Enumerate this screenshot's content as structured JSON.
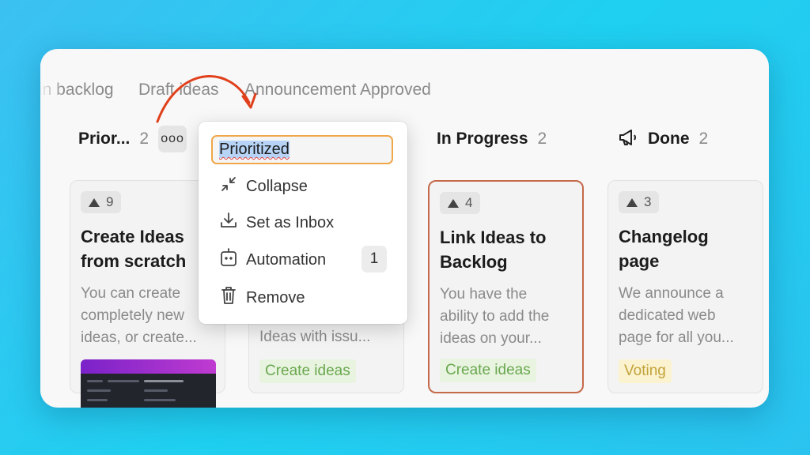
{
  "tabs": [
    "in backlog",
    "Draft ideas",
    "Announcement Approved"
  ],
  "columns": [
    {
      "title": "Prior...",
      "count": "2",
      "more": "ooo"
    },
    {
      "title": "In Progress",
      "count": "2"
    },
    {
      "title": "Done",
      "count": "2",
      "icon": "megaphone-icon"
    }
  ],
  "cards": [
    {
      "votes": "9",
      "title_1": "Create Ideas",
      "title_2": "from scratch",
      "desc_1": "You can create",
      "desc_2": "completely new",
      "desc_3": "ideas, or create..."
    },
    {
      "desc_3": "Ideas with issu...",
      "tag": "Create ideas"
    },
    {
      "votes": "4",
      "title_1": "Link Ideas to",
      "title_2": "Backlog",
      "desc_1": "You have the",
      "desc_2": "ability to add the",
      "desc_3": "ideas on your...",
      "tag": "Create ideas"
    },
    {
      "votes": "3",
      "title_1": "Changelog",
      "title_2": "page",
      "desc_1": "We announce a",
      "desc_2": "dedicated web",
      "desc_3": "page for all you...",
      "tag": "Voting"
    }
  ],
  "menu": {
    "rename_value": "Prioritized",
    "items": [
      "Collapse",
      "Set as Inbox",
      "Automation",
      "Remove"
    ],
    "automation_count": "1"
  },
  "colors": {
    "accent_orange": "#f0a74a",
    "highlight_border": "#c46a4a",
    "arrow_red": "#e0401c"
  }
}
